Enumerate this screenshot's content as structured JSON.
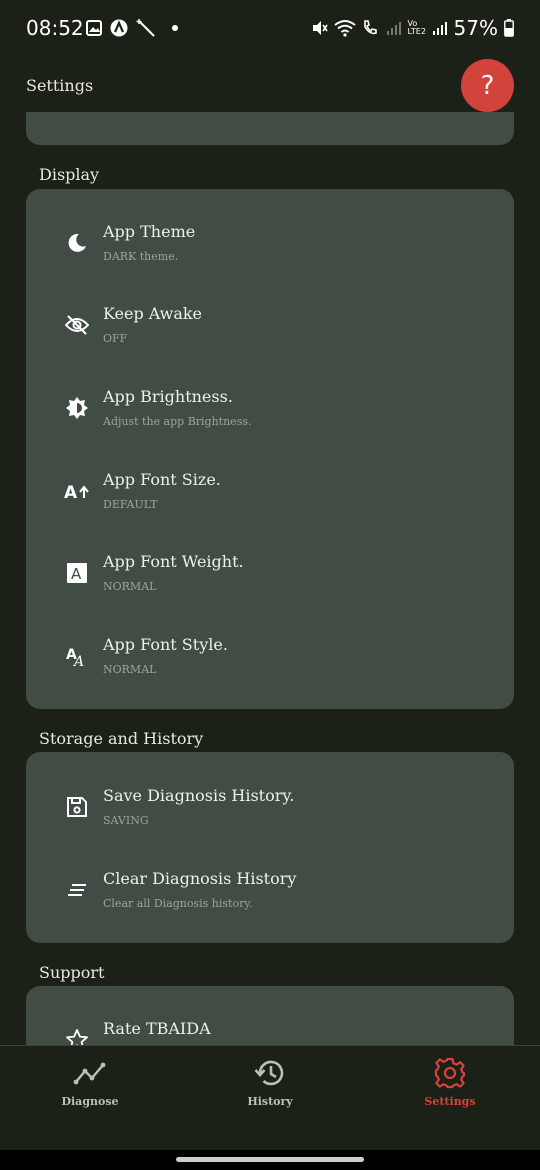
{
  "status_bar": {
    "time": "08:52",
    "battery": "57%",
    "icons_left": [
      "image-icon",
      "app-icon",
      "magic-wand-icon",
      "dot-icon"
    ],
    "icons_right": [
      "mute-icon",
      "wifi-icon",
      "wifi-calling-icon",
      "signal-icon",
      "volte-icon",
      "signal-icon",
      "battery-icon"
    ],
    "volte_label": "Vo LTE2"
  },
  "header": {
    "title": "Settings",
    "help_label": "?"
  },
  "sections": {
    "display": {
      "label": "Display",
      "items": [
        {
          "title": "App Theme",
          "subtitle": "DARK theme.",
          "icon": "moon-icon"
        },
        {
          "title": "Keep Awake",
          "subtitle": "OFF",
          "icon": "eye-off-icon"
        },
        {
          "title": "App Brightness.",
          "subtitle": "Adjust the app Brightness.",
          "icon": "brightness-icon"
        },
        {
          "title": "App Font Size.",
          "subtitle": "DEFAULT",
          "icon": "font-size-icon"
        },
        {
          "title": "App Font Weight.",
          "subtitle": "NORMAL",
          "icon": "font-weight-icon"
        },
        {
          "title": "App Font Style.",
          "subtitle": "NORMAL",
          "icon": "font-style-icon"
        }
      ]
    },
    "storage": {
      "label": "Storage and History",
      "items": [
        {
          "title": "Save Diagnosis History.",
          "subtitle": "SAVING",
          "icon": "save-icon"
        },
        {
          "title": "Clear Diagnosis History",
          "subtitle": "Clear all Diagnosis history.",
          "icon": "clear-all-icon"
        }
      ]
    },
    "support": {
      "label": "Support",
      "items": [
        {
          "title": "Rate TBAIDA",
          "icon": "star-icon"
        }
      ]
    }
  },
  "bottom_nav": {
    "items": [
      {
        "label": "Diagnose",
        "icon": "diagnose-icon",
        "active": false
      },
      {
        "label": "History",
        "icon": "history-icon",
        "active": false
      },
      {
        "label": "Settings",
        "icon": "settings-gear-icon",
        "active": true
      }
    ]
  },
  "colors": {
    "background": "#1c2118",
    "card": "#414d44",
    "accent": "#d2433c",
    "subtitle": "#9aa59c"
  }
}
